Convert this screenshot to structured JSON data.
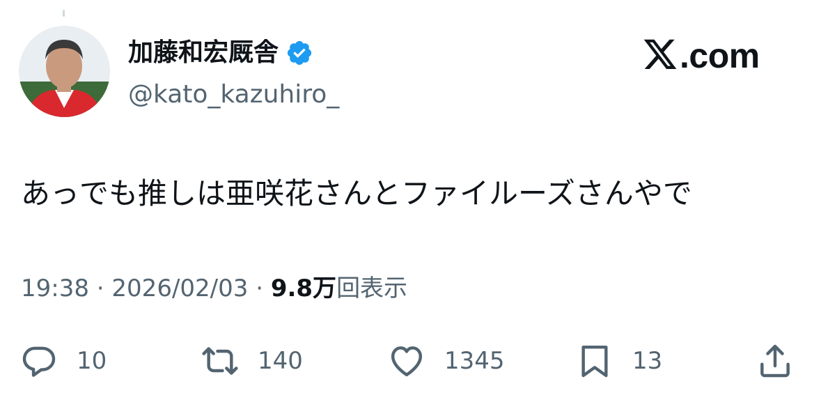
{
  "author": {
    "display_name": "加藤和宏厩舎",
    "handle": "@kato_kazuhiro_",
    "verified_icon": "verified-badge-icon",
    "verified_color": "#1d9bf0"
  },
  "brand": {
    "logo_text": ".com",
    "logo_icon": "x-logo-icon"
  },
  "tweet": {
    "text": "あっでも推しは亜咲花さんとファイルーズさんやで"
  },
  "meta": {
    "time": "19:38",
    "separator1": " · ",
    "date": "2026/02/03",
    "separator2": " · ",
    "views_count": "9.8万",
    "views_label": "回表示"
  },
  "actions": {
    "reply": {
      "count": "10",
      "icon": "reply-icon"
    },
    "repost": {
      "count": "140",
      "icon": "repost-icon"
    },
    "like": {
      "count": "1345",
      "icon": "heart-icon"
    },
    "bookmark": {
      "count": "13",
      "icon": "bookmark-icon"
    },
    "share": {
      "icon": "share-icon"
    }
  },
  "colors": {
    "text_primary": "#0f1419",
    "text_secondary": "#536471",
    "accent": "#1d9bf0"
  }
}
